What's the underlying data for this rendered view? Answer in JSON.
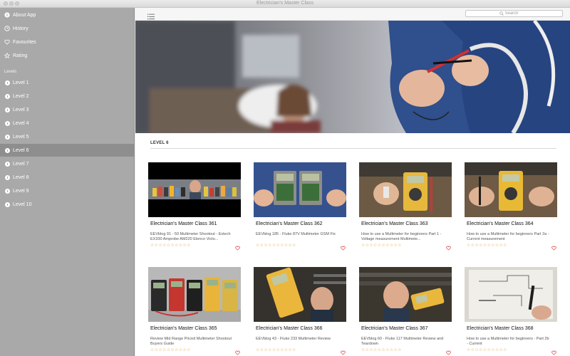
{
  "window": {
    "title": "Electrician's Master Class"
  },
  "sidebar": {
    "top_items": [
      {
        "label": "About App",
        "icon": "info-icon"
      },
      {
        "label": "History",
        "icon": "clock-icon"
      },
      {
        "label": "Favourites",
        "icon": "heart-icon"
      },
      {
        "label": "Rating",
        "icon": "star-icon"
      }
    ],
    "levels_title": "Levels",
    "levels": [
      {
        "label": "Level 1"
      },
      {
        "label": "Level 2"
      },
      {
        "label": "Level 3"
      },
      {
        "label": "Level 4"
      },
      {
        "label": "Level 5"
      },
      {
        "label": "Level 6"
      },
      {
        "label": "Level 7"
      },
      {
        "label": "Level 8"
      },
      {
        "label": "Level 9"
      },
      {
        "label": "Level 10"
      }
    ],
    "selected_level": "Level 6"
  },
  "toolbar": {
    "search_placeholder": "Search",
    "menu_icon": "list-icon"
  },
  "main": {
    "section_title": "LEVEL 6",
    "cards": [
      {
        "title": "Electrician's Master Class 361",
        "desc": "EEVblog 91 - 50 Multimeter Shootout - Extech EX330 Amprobe AM220 Elenco Victo...",
        "rating": "☆☆☆☆☆☆☆☆☆☆"
      },
      {
        "title": "Electrician's Master Class 362",
        "desc": "EEVblog 185 - Fluke 87V Multimeter GSM Fix",
        "rating": "☆☆☆☆☆☆☆☆☆☆"
      },
      {
        "title": "Electrician's Master Class 363",
        "desc": "How to use a Multimeter for beginners Part 1 - Voltage measurement  Multimete...",
        "rating": "☆☆☆☆☆☆☆☆☆☆"
      },
      {
        "title": "Electrician's Master Class 364",
        "desc": "How to use a Multimeter for beginners Part 2a - Current measurement",
        "rating": "☆☆☆☆☆☆☆☆☆☆"
      },
      {
        "title": "Electrician's Master Class 365",
        "desc": "Review Mid Range  Priced Multimeter Shootout Buyers Guide",
        "rating": "☆☆☆☆☆☆☆☆☆☆"
      },
      {
        "title": "Electrician's Master Class 366",
        "desc": "EEVblog 43 - Fluke 233 Multimeter Review",
        "rating": "☆☆☆☆☆☆☆☆☆☆"
      },
      {
        "title": "Electrician's Master Class 367",
        "desc": "EEVblog 60 - Fluke 117 Multimeter Review and Teardown",
        "rating": "☆☆☆☆☆☆☆☆☆☆"
      },
      {
        "title": "Electrician's Master Class 368",
        "desc": "How to use a Multimeter for beginners - Part 2b - Current",
        "rating": "☆☆☆☆☆☆☆☆☆☆"
      }
    ]
  },
  "colors": {
    "sidebar_bg": "#a9a9a9",
    "sidebar_selected": "#8e8e8e",
    "star": "#d9a640",
    "heart": "#e05555"
  }
}
